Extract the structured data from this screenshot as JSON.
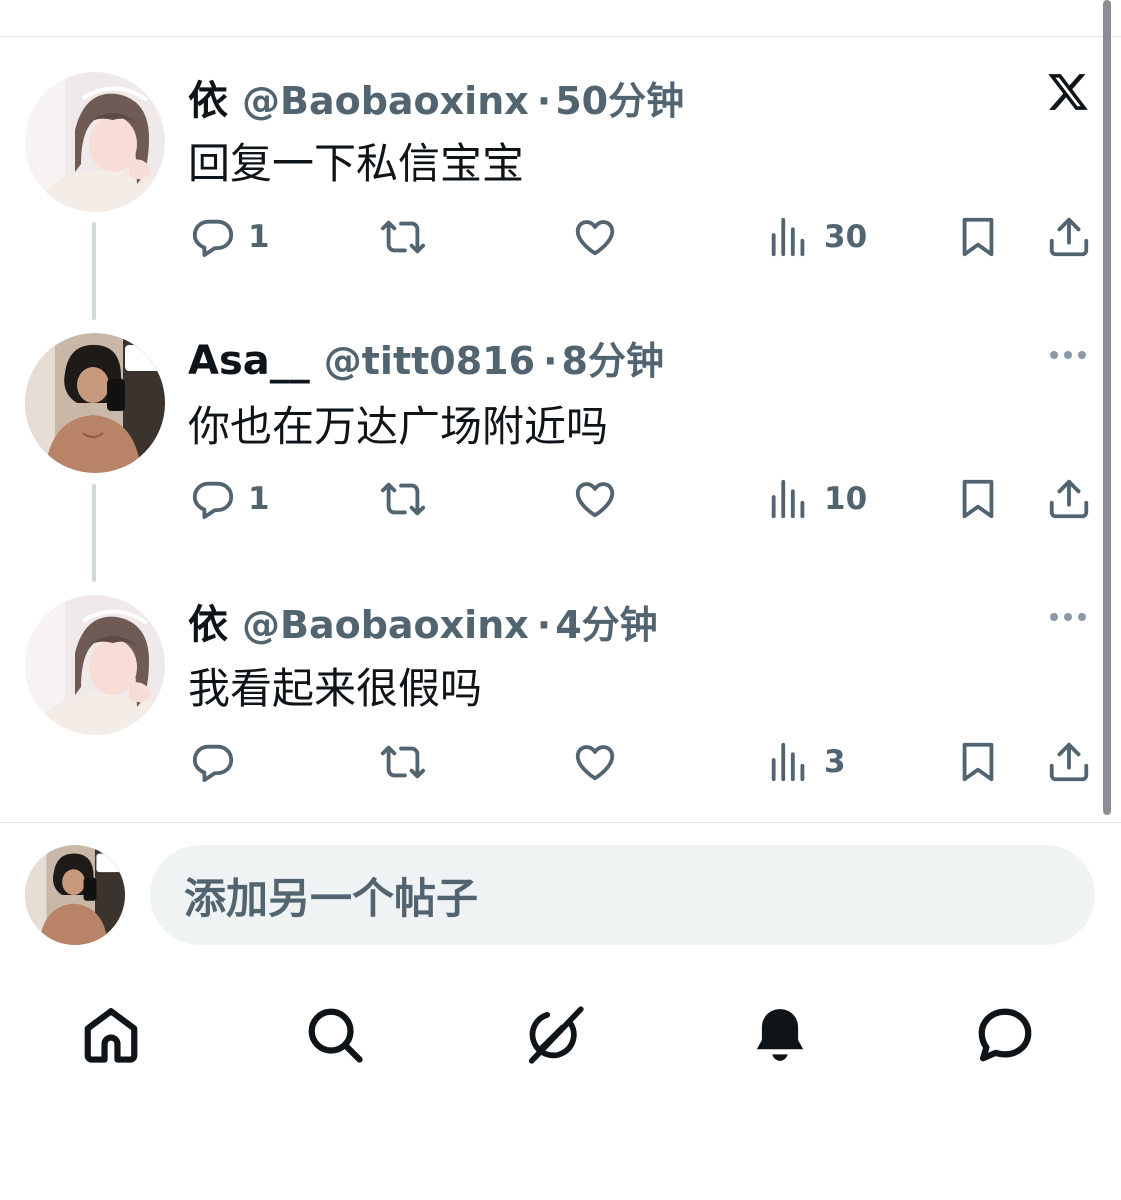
{
  "tweets": [
    {
      "name": "依",
      "handle": "@Baobaoxinx",
      "time": "50分钟",
      "text": "回复一下私信宝宝",
      "replies": "1",
      "retweets": "",
      "likes": "",
      "views": "30"
    },
    {
      "name": "Asa__",
      "handle": "@titt0816",
      "time": "8分钟",
      "text": "你也在万达广场附近吗",
      "replies": "1",
      "retweets": "",
      "likes": "",
      "views": "10"
    },
    {
      "name": "依",
      "handle": "@Baobaoxinx",
      "time": "4分钟",
      "text": "我看起来很假吗",
      "replies": "",
      "retweets": "",
      "likes": "",
      "views": "3"
    }
  ],
  "separator": "·",
  "compose": {
    "placeholder": "添加另一个帖子"
  },
  "nav": [
    "home-icon",
    "search-icon",
    "grok-icon",
    "notifications-icon",
    "messages-icon"
  ],
  "colors": {
    "text_primary": "#0f1419",
    "text_secondary": "#536471",
    "thread_line": "#cfd9de",
    "input_bg": "#eff3f4"
  }
}
